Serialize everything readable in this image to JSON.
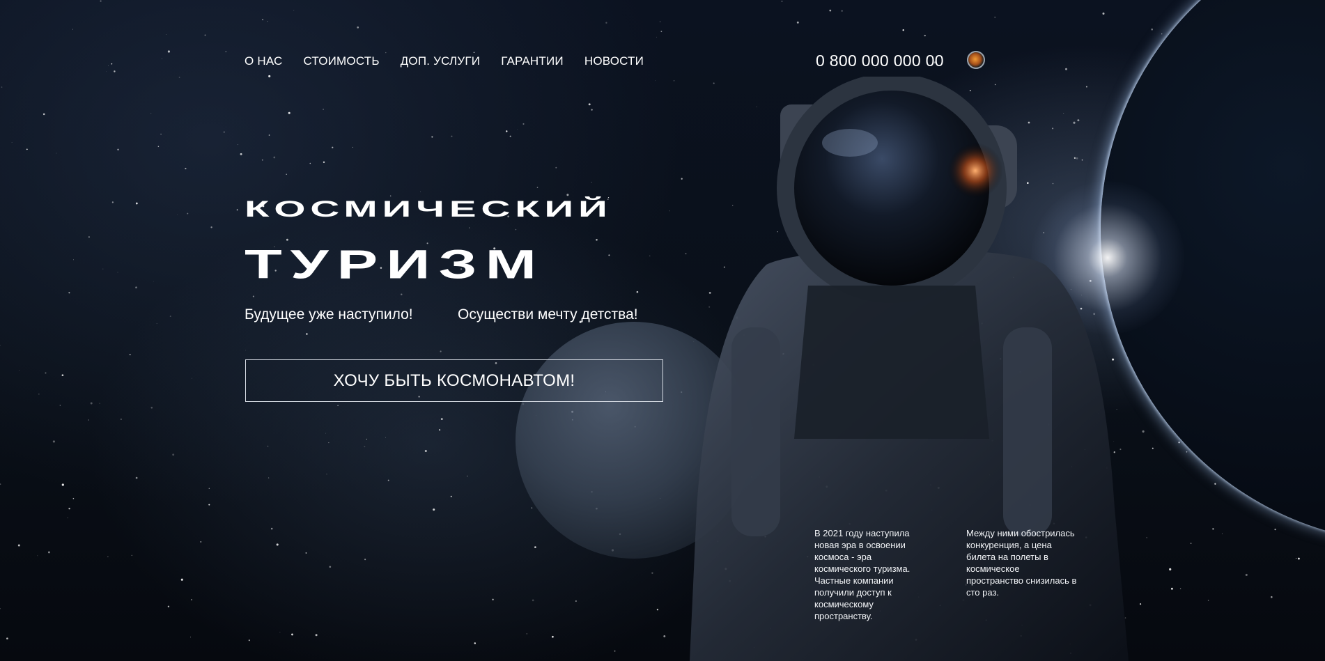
{
  "nav": {
    "items": [
      "О НАС",
      "СТОИМОСТЬ",
      "ДОП. УСЛУГИ",
      "ГАРАНТИИ",
      "НОВОСТИ"
    ]
  },
  "header": {
    "phone": "0 800 000 000 00"
  },
  "hero": {
    "title_line1": "КОСМИЧЕСКИЙ",
    "title_line2": "ТУРИЗМ",
    "tagline_left": "Будущее уже наступило!",
    "tagline_right": "Осуществи мечту детства!",
    "cta_label": "ХОЧУ БЫТЬ КОСМОНАВТОМ!"
  },
  "info": {
    "left": "В 2021 году наступила новая эра в освоении космоса - эра космического туризма. Частные компании получили доступ к космическому пространству.",
    "right": "Между ними обострилась конкуренция, а цена билета на полеты в космическое пространство снизилась в сто раз."
  }
}
